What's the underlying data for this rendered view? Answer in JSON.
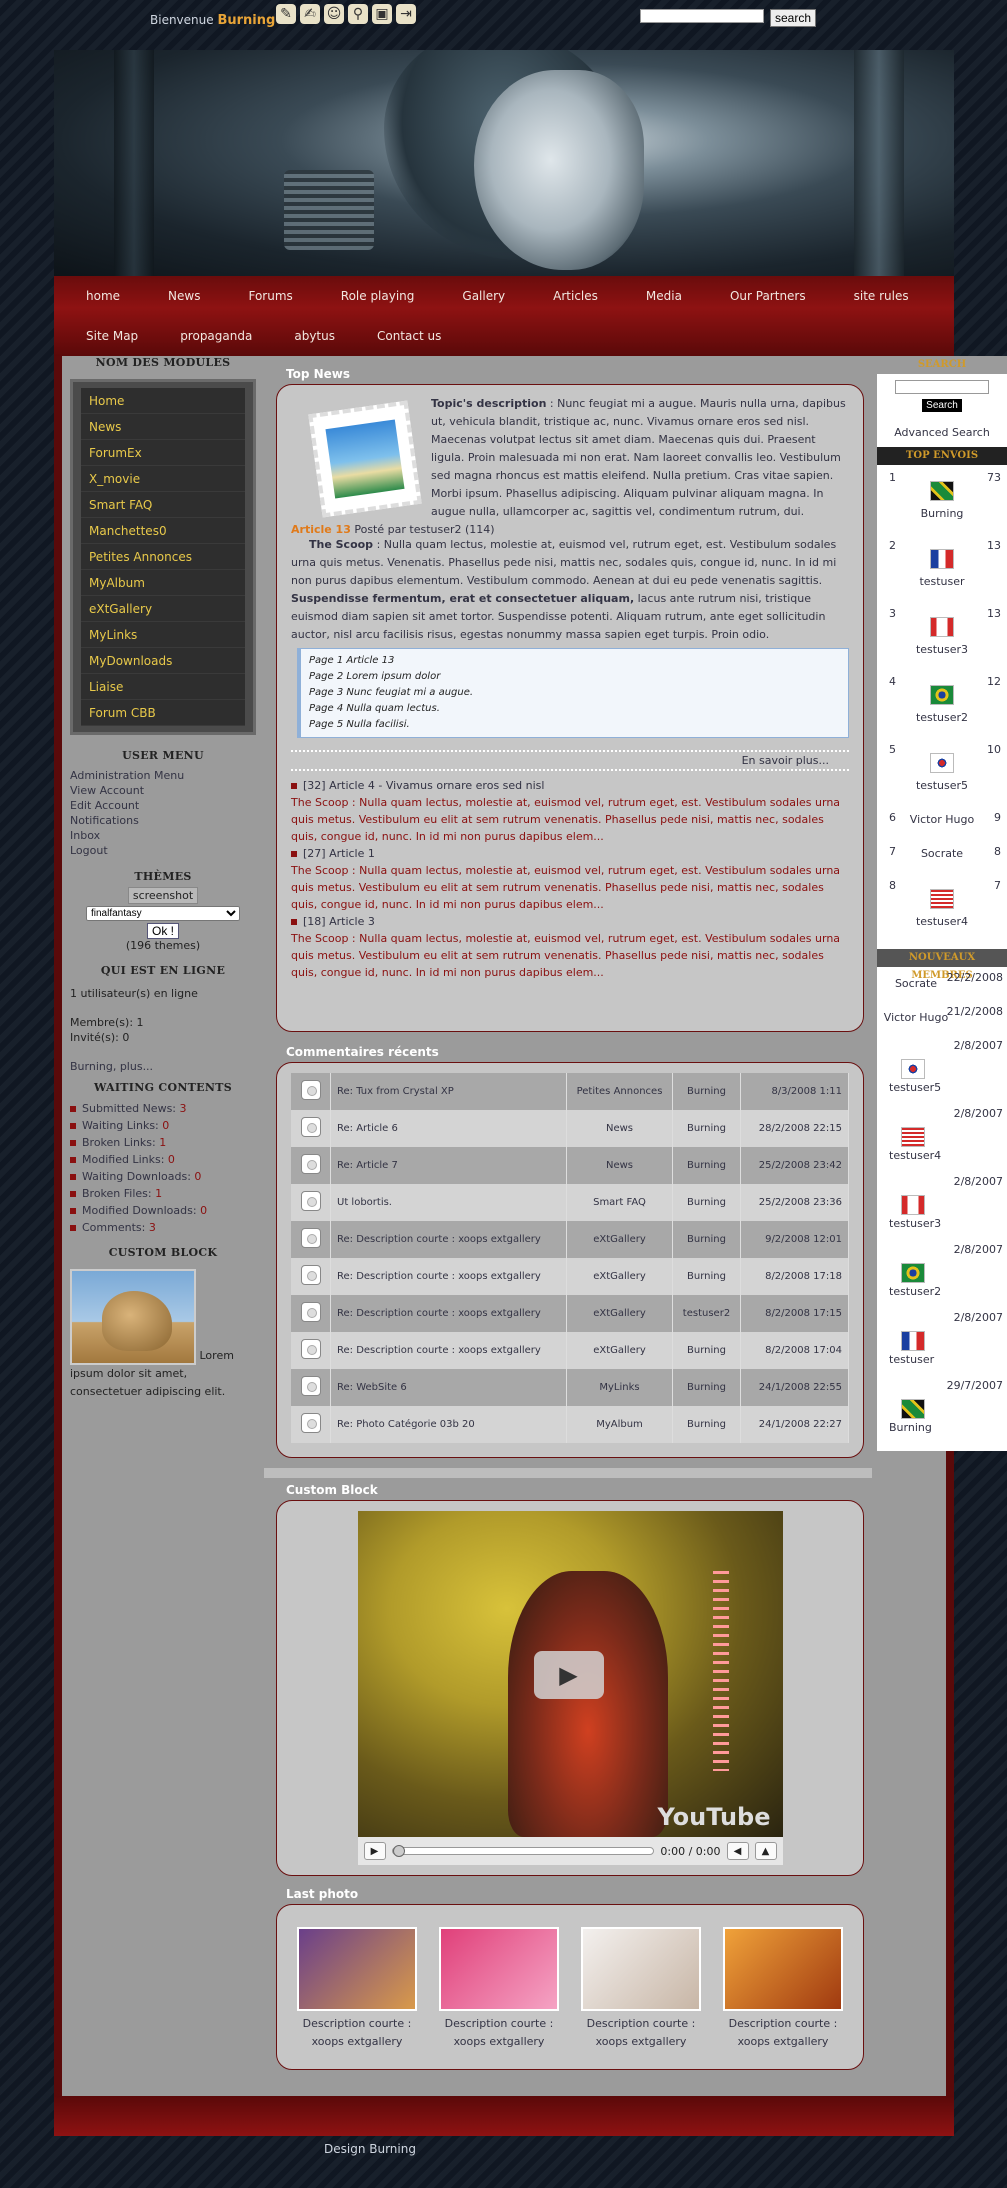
{
  "topbar": {
    "welcome": "Bienvenue",
    "username": "Burning",
    "separator": ":",
    "search_button": "search",
    "search_placeholder": ""
  },
  "nav": {
    "row1": [
      "home",
      "News",
      "Forums",
      "Role playing",
      "Gallery",
      "Articles",
      "Media",
      "Our Partners",
      "site rules"
    ],
    "row2": [
      "Site Map",
      "propaganda",
      "abytus",
      "Contact us"
    ]
  },
  "left": {
    "modules_title": "NOM DES MODULES",
    "modules": [
      "Home",
      "News",
      "ForumEx",
      "X_movie",
      "Smart FAQ",
      "Manchettes0",
      "Petites Annonces",
      "MyAlbum",
      "eXtGallery",
      "MyLinks",
      "MyDownloads",
      "Liaise",
      "Forum CBB"
    ],
    "usermenu_title": "USER MENU",
    "usermenu": [
      "Administration Menu",
      "View Account",
      "Edit Account",
      "Notifications",
      "Inbox",
      "Logout"
    ],
    "themes_title": "THÈMES",
    "themes_screenshot": "screenshot",
    "themes_selected": "finalfantasy",
    "themes_ok": "Ok !",
    "themes_count": "(196 themes)",
    "online_title": "QUI EST EN LIGNE",
    "online_line": "1 utilisateur(s) en ligne",
    "members": "Membre(s): 1",
    "guests": "Invité(s): 0",
    "online_users": "Burning, plus...",
    "waiting_title": "WAITING CONTENTS",
    "waiting": [
      {
        "label": "Submitted News:",
        "value": "3"
      },
      {
        "label": "Waiting Links:",
        "value": "0"
      },
      {
        "label": "Broken Links:",
        "value": "1"
      },
      {
        "label": "Modified Links:",
        "value": "0"
      },
      {
        "label": "Waiting Downloads:",
        "value": "0"
      },
      {
        "label": "Broken Files:",
        "value": "1"
      },
      {
        "label": "Modified Downloads:",
        "value": "0"
      },
      {
        "label": "Comments:",
        "value": "3"
      }
    ],
    "custom_title": "CUSTOM BLOCK",
    "custom_text": "Lorem ipsum dolor sit amet, consectetuer adipiscing elit."
  },
  "center": {
    "topnews_title": "Top News",
    "topic_desc_label": "Topic's description",
    "topic_desc": ": Nunc feugiat mi a augue. Mauris nulla urna, dapibus ut, vehicula blandit, tristique ac, nunc. Vivamus ornare eros sed nisl. Maecenas volutpat lectus sit amet diam. Maecenas quis dui. Praesent ligula. Proin malesuada mi non erat. Nam laoreet convallis leo. Vestibulum sed magna rhoncus est mattis eleifend. Nulla pretium. Cras vitae sapien. Morbi ipsum. Phasellus adipiscing. Aliquam pulvinar aliquam magna. In augue nulla, ullamcorper ac, sagittis vel, condimentum rutrum, dui.",
    "article_title": "Article 13",
    "article_meta": "Posté par testuser2 (114)",
    "scoop_label": "The Scoop",
    "scoop_text": ": Nulla quam lectus, molestie at, euismod vel, rutrum eget, est. Vestibulum sodales urna quis metus. Venenatis. Phasellus pede nisi, mattis nec, sodales quis, congue id, nunc. In id mi non purus dapibus elementum. Vestibulum commodo. Aenean at dui eu pede venenatis sagittis.",
    "scoop_bold": "Suspendisse fermentum, erat et consectetuer aliquam,",
    "scoop_text2": "lacus ante rutrum nisi, tristique euismod diam sapien sit amet tortor. Suspendisse potenti. Aliquam rutrum, ante eget sollicitudin auctor, nisl arcu facilisis risus, egestas nonummy massa sapien eget turpis. Proin odio.",
    "pages": [
      "Page 1 Article 13",
      "Page 2 Lorem ipsum dolor",
      "Page 3 Nunc feugiat mi a augue.",
      "Page 4 Nulla quam lectus.",
      "Page 5 Nulla facilisi."
    ],
    "read_more": "En savoir plus...",
    "articles": [
      {
        "count": "[32]",
        "title": "Article 4 - Vivamus ornare eros sed nisl",
        "body": "The Scoop : Nulla quam lectus, molestie at, euismod vel, rutrum eget, est. Vestibulum sodales urna quis metus. Vestibulum eu elit at sem rutrum venenatis. Phasellus pede nisi, mattis nec, sodales quis, congue id, nunc. In id mi non purus dapibus elem..."
      },
      {
        "count": "[27]",
        "title": "Article 1",
        "body": "The Scoop : Nulla quam lectus, molestie at, euismod vel, rutrum eget, est. Vestibulum sodales urna quis metus. Vestibulum eu elit at sem rutrum venenatis. Phasellus pede nisi, mattis nec, sodales quis, congue id, nunc. In id mi non purus dapibus elem..."
      },
      {
        "count": "[18]",
        "title": "Article 3",
        "body": "The Scoop : Nulla quam lectus, molestie at, euismod vel, rutrum eget, est. Vestibulum sodales urna quis metus. Vestibulum eu elit at sem rutrum venenatis. Phasellus pede nisi, mattis nec, sodales quis, congue id, nunc. In id mi non purus dapibus elem..."
      }
    ],
    "comments_title": "Commentaires récents",
    "comments": [
      {
        "title": "Re: Tux from Crystal XP",
        "module": "Petites Annonces",
        "user": "Burning",
        "date": "8/3/2008 1:11"
      },
      {
        "title": "Re: Article 6",
        "module": "News",
        "user": "Burning",
        "date": "28/2/2008 22:15"
      },
      {
        "title": "Re: Article 7",
        "module": "News",
        "user": "Burning",
        "date": "25/2/2008 23:42"
      },
      {
        "title": "Ut lobortis.",
        "module": "Smart FAQ",
        "user": "Burning",
        "date": "25/2/2008 23:36"
      },
      {
        "title": "Re: Description courte : xoops extgallery",
        "module": "eXtGallery",
        "user": "Burning",
        "date": "9/2/2008 12:01"
      },
      {
        "title": "Re: Description courte : xoops extgallery",
        "module": "eXtGallery",
        "user": "Burning",
        "date": "8/2/2008 17:18"
      },
      {
        "title": "Re: Description courte : xoops extgallery",
        "module": "eXtGallery",
        "user": "testuser2",
        "date": "8/2/2008 17:15"
      },
      {
        "title": "Re: Description courte : xoops extgallery",
        "module": "eXtGallery",
        "user": "Burning",
        "date": "8/2/2008 17:04"
      },
      {
        "title": "Re: WebSite 6",
        "module": "MyLinks",
        "user": "Burning",
        "date": "24/1/2008 22:55"
      },
      {
        "title": "Re: Photo Catégorie 03b 20",
        "module": "MyAlbum",
        "user": "Burning",
        "date": "24/1/2008 22:27"
      }
    ],
    "custom_title": "Custom Block",
    "video_time": "0:00 / 0:00",
    "video_brand": "YouTube",
    "lastphoto_title": "Last photo",
    "photos": [
      {
        "caption": "Description courte : xoops extgallery",
        "c1": "#6a3f8a",
        "c2": "#d99a4a"
      },
      {
        "caption": "Description courte : xoops extgallery",
        "c1": "#e0407a",
        "c2": "#f5a3c4"
      },
      {
        "caption": "Description courte : xoops extgallery",
        "c1": "#f3f0ee",
        "c2": "#c8b6a6"
      },
      {
        "caption": "Description courte : xoops extgallery",
        "c1": "#f0a23a",
        "c2": "#a03a10"
      }
    ]
  },
  "right": {
    "search_title": "SEARCH",
    "search_button": "Search",
    "advanced": "Advanced Search",
    "top_title": "TOP ENVOIS",
    "top": [
      {
        "rank": "1",
        "name": "Burning",
        "count": "73",
        "flag": "jamaica"
      },
      {
        "rank": "2",
        "name": "testuser",
        "count": "13",
        "flag": "france"
      },
      {
        "rank": "3",
        "name": "testuser3",
        "count": "13",
        "flag": "canada"
      },
      {
        "rank": "4",
        "name": "testuser2",
        "count": "12",
        "flag": "brazil"
      },
      {
        "rank": "5",
        "name": "testuser5",
        "count": "10",
        "flag": "korea"
      },
      {
        "rank": "6",
        "name": "Victor Hugo",
        "count": "9",
        "flag": ""
      },
      {
        "rank": "7",
        "name": "Socrate",
        "count": "8",
        "flag": ""
      },
      {
        "rank": "8",
        "name": "testuser4",
        "count": "7",
        "flag": "usa"
      }
    ],
    "new_title": "NOUVEAUX MEMBRES",
    "new": [
      {
        "name": "Socrate",
        "date": "22/2/2008",
        "flag": ""
      },
      {
        "name": "Victor Hugo",
        "date": "21/2/2008",
        "flag": ""
      },
      {
        "name": "testuser5",
        "date": "2/8/2007",
        "flag": "korea"
      },
      {
        "name": "testuser4",
        "date": "2/8/2007",
        "flag": "usa"
      },
      {
        "name": "testuser3",
        "date": "2/8/2007",
        "flag": "canada"
      },
      {
        "name": "testuser2",
        "date": "2/8/2007",
        "flag": "brazil"
      },
      {
        "name": "testuser",
        "date": "2/8/2007",
        "flag": "france"
      },
      {
        "name": "Burning",
        "date": "29/7/2007",
        "flag": "jamaica"
      }
    ]
  },
  "footer": "Design Burning"
}
